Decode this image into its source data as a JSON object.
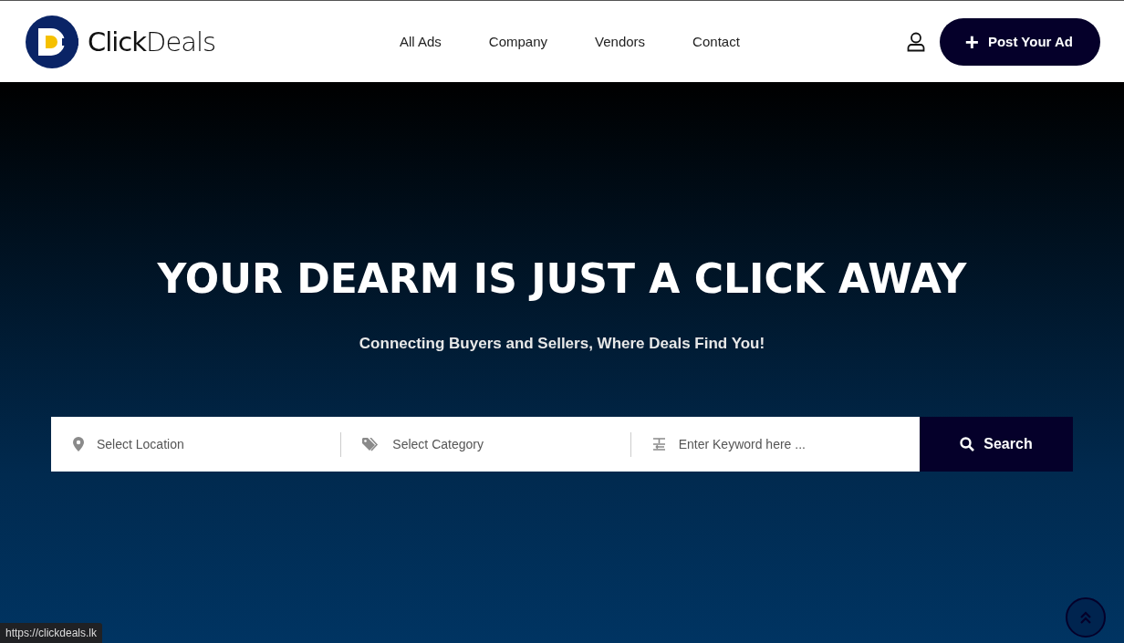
{
  "header": {
    "logo_text": "**Click**Deals",
    "nav": [
      {
        "label": "All Ads"
      },
      {
        "label": "Company"
      },
      {
        "label": "Vendors"
      },
      {
        "label": "Contact"
      }
    ],
    "post_button": {
      "icon": "+",
      "label": "Post Your Ad"
    }
  },
  "hero": {
    "title": "YOUR DEARM IS JUST A CLICK AWAY",
    "subtitle": "Connecting Buyers and Sellers, Where Deals Find You!"
  },
  "search": {
    "fields": [
      {
        "kind": "location",
        "placeholder": "Select Location"
      },
      {
        "kind": "category",
        "placeholder": "Select Category"
      },
      {
        "kind": "keyword",
        "placeholder": "Enter Keyword here ..."
      }
    ],
    "button": "Search"
  },
  "status_bar": {
    "url": "https://clickdeals.lk"
  }
}
